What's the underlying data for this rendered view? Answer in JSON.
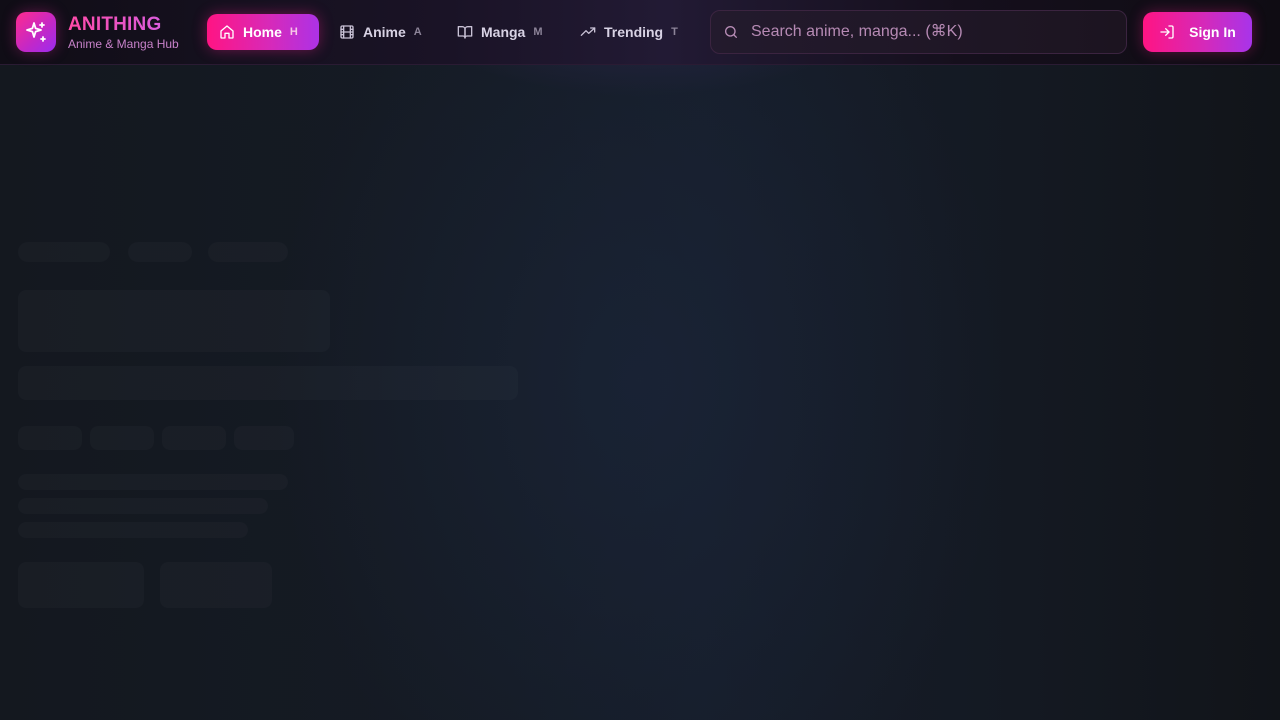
{
  "brand": {
    "title": "ANITHING",
    "subtitle": "Anime & Manga Hub",
    "icon": "sparkles-icon"
  },
  "nav": {
    "items": [
      {
        "label": "Home",
        "shortcut": "H",
        "icon": "home-icon",
        "active": true
      },
      {
        "label": "Anime",
        "shortcut": "A",
        "icon": "film-icon",
        "active": false
      },
      {
        "label": "Manga",
        "shortcut": "M",
        "icon": "book-open-icon",
        "active": false
      },
      {
        "label": "Trending",
        "shortcut": "T",
        "icon": "trending-up-icon",
        "active": false
      }
    ]
  },
  "search": {
    "placeholder": "Search anime, manga... (⌘K)",
    "value": "",
    "icon": "search-icon"
  },
  "auth": {
    "signin_label": "Sign In",
    "icon": "log-in-icon"
  },
  "colors": {
    "accent_pink": "#ff1483",
    "accent_purple": "#a834ea",
    "background": "#121720"
  }
}
